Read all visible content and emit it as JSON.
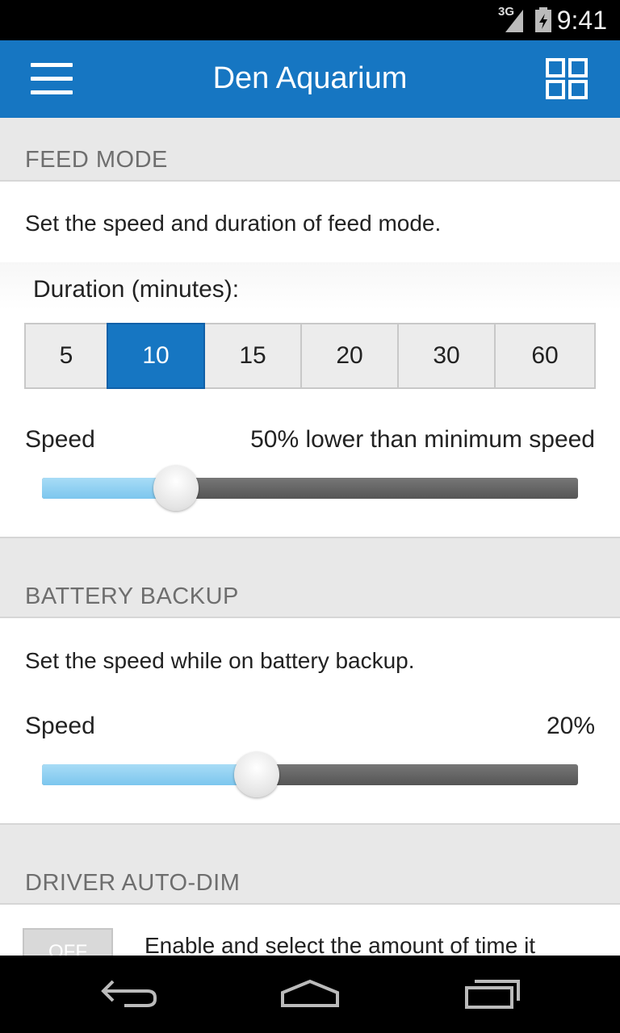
{
  "status_bar": {
    "network": "3G",
    "time": "9:41"
  },
  "app_bar": {
    "title": "Den Aquarium",
    "menu_icon": "hamburger-menu-icon",
    "grid_icon": "grid-view-icon"
  },
  "feed_mode": {
    "header": "FEED MODE",
    "description": "Set the speed and duration of feed mode.",
    "duration_label": "Duration (minutes):",
    "durations": [
      "5",
      "10",
      "15",
      "20",
      "30",
      "60"
    ],
    "selected_duration": "10",
    "speed_label": "Speed",
    "speed_value": "50% lower than minimum speed",
    "slider_level": 0.25
  },
  "battery_backup": {
    "header": "BATTERY BACKUP",
    "description": "Set the speed while on battery backup.",
    "speed_label": "Speed",
    "speed_value": "20%",
    "slider_level": 0.4
  },
  "driver_auto_dim": {
    "header": "DRIVER AUTO-DIM",
    "toggle_label": "OFF",
    "description": "Enable and select the amount of time it"
  },
  "colors": {
    "accent": "#1676c2",
    "slider_fill": "#8fd0f2",
    "track": "#666666"
  }
}
